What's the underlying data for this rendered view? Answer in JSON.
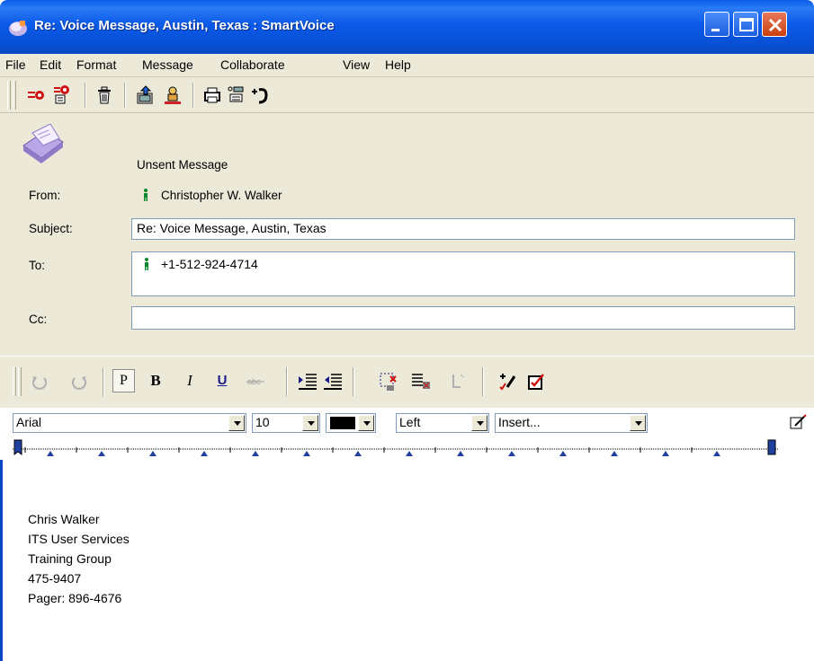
{
  "window": {
    "title": "Re: Voice Message, Austin, Texas : SmartVoice",
    "buttons": [
      "minimize",
      "maximize",
      "close"
    ]
  },
  "menu": [
    "File",
    "Edit",
    "Format",
    "Message",
    "Collaborate",
    "View",
    "Help"
  ],
  "toolbar": {
    "icons": [
      "send-icon",
      "send-options-icon",
      "delete-icon",
      "address-book-icon",
      "check-names-icon",
      "print-icon",
      "record-icon",
      "play-icon"
    ]
  },
  "header": {
    "status": "Unsent Message",
    "from_label": "From:",
    "from_value": "Christopher W. Walker",
    "subject_label": "Subject:",
    "subject_value": "Re: Voice Message, Austin, Texas",
    "to_label": "To:",
    "to_value": "+1-512-924-4714",
    "cc_label": "Cc:",
    "cc_value": ""
  },
  "format": {
    "paragraph": "P",
    "bold": "B",
    "italic": "I",
    "underline": "U",
    "font": "Arial",
    "size": "10",
    "align": "Left",
    "insert": "Insert..."
  },
  "body": {
    "lines": [
      "Chris Walker",
      "ITS User Services",
      "Training Group",
      "475-9407",
      "Pager: 896-4676"
    ]
  },
  "colors": {
    "titlebar": "#0a5ae8",
    "chrome": "#ece9d8",
    "field_border": "#7f9db9"
  }
}
